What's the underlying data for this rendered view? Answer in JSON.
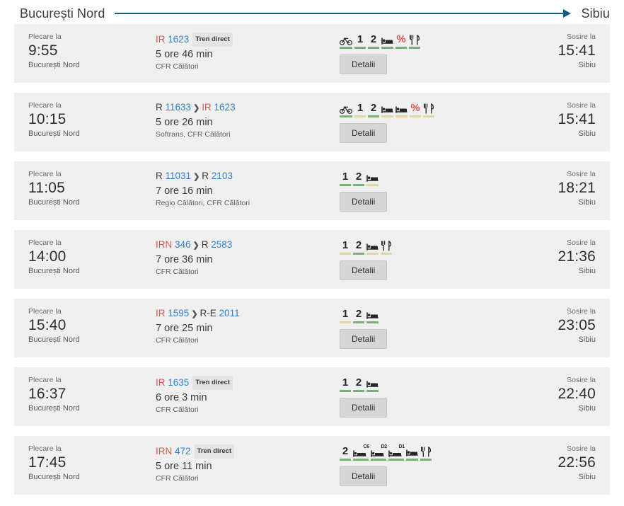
{
  "route": {
    "origin": "București Nord",
    "destination": "Sibiu",
    "arrow_icon": "arrow-right-icon"
  },
  "labels": {
    "departure_prefix": "Plecare la",
    "arrival_prefix": "Sosire la",
    "details_button": "Detalii",
    "direct_badge": "Tren direct"
  },
  "colors": {
    "accent_line": "#0b5f7e",
    "train_number": "#2f7fd0",
    "train_code_express": "#d9534f",
    "amenity_green": "#77b177",
    "amenity_yellow": "#e2d79a",
    "row_background": "#f0f0f0"
  },
  "results": [
    {
      "departure_time": "9:55",
      "departure_station": "București Nord",
      "arrival_time": "15:41",
      "arrival_station": "Sibiu",
      "duration": "5 ore 46 min",
      "operator": "CFR Călători",
      "direct": true,
      "segments": [
        {
          "code": "IR",
          "code_type": "ir",
          "number": "1623"
        }
      ],
      "amenities": [
        {
          "icon": "bicycle-icon",
          "type": "bike",
          "bar": "green"
        },
        {
          "icon": "class-1-icon",
          "type": "class",
          "text": "1",
          "bar": "green"
        },
        {
          "icon": "class-2-icon",
          "type": "class",
          "text": "2",
          "bar": "green"
        },
        {
          "icon": "sleeping-car-icon",
          "type": "bed",
          "bar": "green"
        },
        {
          "icon": "discount-icon",
          "type": "percent",
          "text": "%",
          "bar": "green"
        },
        {
          "icon": "restaurant-icon",
          "type": "food",
          "bar": "green"
        }
      ]
    },
    {
      "departure_time": "10:15",
      "departure_station": "București Nord",
      "arrival_time": "15:41",
      "arrival_station": "Sibiu",
      "duration": "5 ore 26 min",
      "operator": "Softrans, CFR Călători",
      "direct": false,
      "segments": [
        {
          "code": "R",
          "code_type": "r",
          "number": "11633"
        },
        {
          "code": "IR",
          "code_type": "ir",
          "number": "1623"
        }
      ],
      "amenities": [
        {
          "icon": "bicycle-icon",
          "type": "bike",
          "bar": "green"
        },
        {
          "icon": "class-1-icon",
          "type": "class",
          "text": "1",
          "bar": "yellow"
        },
        {
          "icon": "class-2-icon",
          "type": "class",
          "text": "2",
          "bar": "green"
        },
        {
          "icon": "sleeping-car-icon",
          "type": "bed",
          "bar": "yellow"
        },
        {
          "icon": "sleeping-car-icon",
          "type": "bed",
          "bar": "yellow"
        },
        {
          "icon": "discount-icon",
          "type": "percent",
          "text": "%",
          "bar": "yellow"
        },
        {
          "icon": "restaurant-icon",
          "type": "food",
          "bar": "yellow"
        }
      ]
    },
    {
      "departure_time": "11:05",
      "departure_station": "București Nord",
      "arrival_time": "18:21",
      "arrival_station": "Sibiu",
      "duration": "7 ore 16 min",
      "operator": "Regio Călători, CFR Călători",
      "direct": false,
      "segments": [
        {
          "code": "R",
          "code_type": "r",
          "number": "11031"
        },
        {
          "code": "R",
          "code_type": "r",
          "number": "2103"
        }
      ],
      "amenities": [
        {
          "icon": "class-1-icon",
          "type": "class",
          "text": "1",
          "bar": "green"
        },
        {
          "icon": "class-2-icon",
          "type": "class",
          "text": "2",
          "bar": "green"
        },
        {
          "icon": "sleeping-car-icon",
          "type": "bed",
          "bar": "yellow"
        }
      ]
    },
    {
      "departure_time": "14:00",
      "departure_station": "București Nord",
      "arrival_time": "21:36",
      "arrival_station": "Sibiu",
      "duration": "7 ore 36 min",
      "operator": "CFR Călători",
      "direct": false,
      "segments": [
        {
          "code": "IRN",
          "code_type": "irn",
          "number": "346"
        },
        {
          "code": "R",
          "code_type": "r",
          "number": "2583"
        }
      ],
      "amenities": [
        {
          "icon": "class-1-icon",
          "type": "class",
          "text": "1",
          "bar": "yellow"
        },
        {
          "icon": "class-2-icon",
          "type": "class",
          "text": "2",
          "bar": "green"
        },
        {
          "icon": "sleeping-car-icon",
          "type": "bed",
          "bar": "yellow"
        },
        {
          "icon": "restaurant-icon",
          "type": "food",
          "bar": "yellow"
        }
      ]
    },
    {
      "departure_time": "15:40",
      "departure_station": "București Nord",
      "arrival_time": "23:05",
      "arrival_station": "Sibiu",
      "duration": "7 ore 25 min",
      "operator": "CFR Călători",
      "direct": false,
      "segments": [
        {
          "code": "IR",
          "code_type": "ir",
          "number": "1595"
        },
        {
          "code": "R-E",
          "code_type": "re",
          "number": "2011"
        }
      ],
      "amenities": [
        {
          "icon": "class-1-icon",
          "type": "class",
          "text": "1",
          "bar": "yellow"
        },
        {
          "icon": "class-2-icon",
          "type": "class",
          "text": "2",
          "bar": "green"
        },
        {
          "icon": "sleeping-car-icon",
          "type": "bed",
          "bar": "green"
        }
      ]
    },
    {
      "departure_time": "16:37",
      "departure_station": "București Nord",
      "arrival_time": "22:40",
      "arrival_station": "Sibiu",
      "duration": "6 ore 3 min",
      "operator": "CFR Călători",
      "direct": true,
      "segments": [
        {
          "code": "IR",
          "code_type": "ir",
          "number": "1635"
        }
      ],
      "amenities": [
        {
          "icon": "class-1-icon",
          "type": "class",
          "text": "1",
          "bar": "green"
        },
        {
          "icon": "class-2-icon",
          "type": "class",
          "text": "2",
          "bar": "green"
        },
        {
          "icon": "sleeping-car-icon",
          "type": "bed",
          "bar": "green"
        }
      ]
    },
    {
      "departure_time": "17:45",
      "departure_station": "București Nord",
      "arrival_time": "22:56",
      "arrival_station": "Sibiu",
      "duration": "5 ore 11 min",
      "operator": "CFR Călători",
      "direct": true,
      "segments": [
        {
          "code": "IRN",
          "code_type": "irn",
          "number": "472"
        }
      ],
      "amenities": [
        {
          "icon": "class-2-icon",
          "type": "class",
          "text": "2",
          "bar": "green"
        },
        {
          "icon": "couchette-c6-icon",
          "type": "bed-label",
          "text": "C6",
          "bar": "green"
        },
        {
          "icon": "sleeper-d2-icon",
          "type": "bed-label",
          "text": "D2",
          "bar": "green"
        },
        {
          "icon": "sleeper-d1-icon",
          "type": "bed-label",
          "text": "D1",
          "bar": "green"
        },
        {
          "icon": "sleeping-car-icon",
          "type": "bed",
          "bar": "green"
        },
        {
          "icon": "restaurant-icon",
          "type": "food",
          "bar": "green"
        }
      ]
    }
  ]
}
